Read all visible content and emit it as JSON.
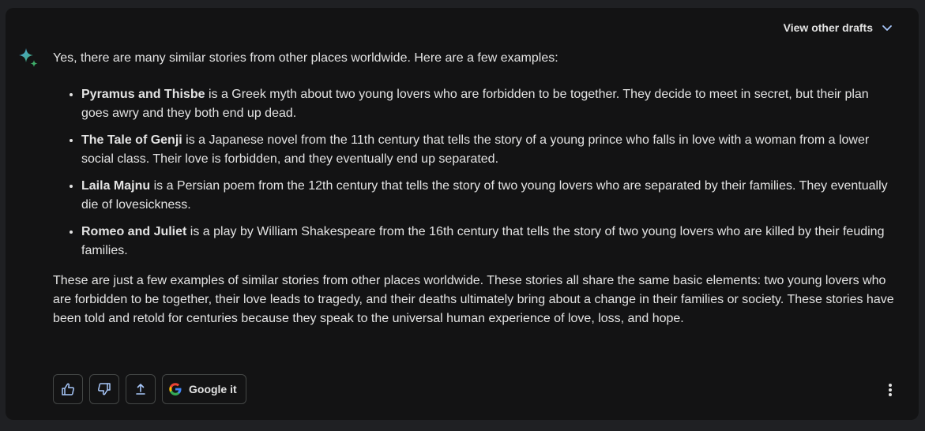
{
  "header": {
    "view_drafts_label": "View other drafts"
  },
  "response": {
    "intro": "Yes, there are many similar stories from other places worldwide. Here are a few examples:",
    "items": [
      {
        "title": "Pyramus and Thisbe",
        "text": " is a Greek myth about two young lovers who are forbidden to be together. They decide to meet in secret, but their plan goes awry and they both end up dead."
      },
      {
        "title": "The Tale of Genji",
        "text": " is a Japanese novel from the 11th century that tells the story of a young prince who falls in love with a woman from a lower social class. Their love is forbidden, and they eventually end up separated."
      },
      {
        "title": "Laila Majnu",
        "text": " is a Persian poem from the 12th century that tells the story of two young lovers who are separated by their families. They eventually die of lovesickness."
      },
      {
        "title": "Romeo and Juliet",
        "text": " is a play by William Shakespeare from the 16th century that tells the story of two young lovers who are killed by their feuding families."
      }
    ],
    "outro": "These are just a few examples of similar stories from other places worldwide. These stories all share the same basic elements: two young lovers who are forbidden to be together, their love leads to tragedy, and their deaths ultimately bring about a change in their families or society. These stories have been told and retold for centuries because they speak to the universal human experience of love, loss, and hope."
  },
  "actions": {
    "google_it_label": "Google it"
  },
  "icons": {
    "sparkle": "sparkle-icon",
    "chevron": "chevron-down-icon",
    "thumbs_up": "thumbs-up-icon",
    "thumbs_down": "thumbs-down-icon",
    "share": "share-icon",
    "google": "google-logo-icon",
    "more": "more-vert-icon"
  },
  "colors": {
    "page_background": "#1f2023",
    "card_background": "#131314",
    "text": "#e3e3e3",
    "icon_accent": "#a8c7fa",
    "button_border": "#444746"
  }
}
